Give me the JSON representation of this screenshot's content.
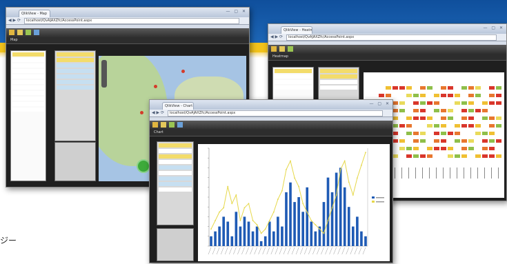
{
  "caption": "ジー",
  "colors": {
    "banner_blue": "#1d66b6",
    "banner_yellow": "#f1c21b",
    "bar": "#1f5bb5",
    "line": "#e6d84a"
  },
  "left_window": {
    "tab_title": "QlikView - Map",
    "url": "localhost/QvAJAXZfc/AccessPoint.aspx",
    "sheet_label": "Map",
    "icons": [
      "back-icon",
      "forward-icon",
      "reload-icon",
      "star-icon",
      "wrench-icon"
    ]
  },
  "right_window": {
    "tab_title": "QlikView - Heatmap",
    "url": "localhost/QvAJAXZfc/AccessPoint.aspx",
    "sheet_label": "Heatmap"
  },
  "front_window": {
    "tab_title": "QlikView - Chart",
    "url": "localhost/QvAJAXZfc/AccessPoint.aspx",
    "sheet_label": "Chart"
  },
  "chart_data": {
    "type": "bar",
    "series": [
      {
        "values": [
          2,
          3,
          4,
          6,
          5,
          2,
          7,
          4,
          6,
          5,
          3,
          4,
          1,
          2,
          5,
          3,
          6,
          4,
          11,
          13,
          9,
          10,
          7,
          12,
          5,
          3,
          4,
          9,
          14,
          11,
          15,
          16,
          12,
          8,
          4,
          6,
          3,
          2
        ]
      },
      {
        "values": [
          4,
          6,
          8,
          9,
          14,
          10,
          12,
          6,
          9,
          10,
          6,
          5,
          3,
          4,
          6,
          8,
          11,
          13,
          18,
          20,
          16,
          14,
          10,
          8,
          6,
          5,
          4,
          3,
          6,
          9,
          12,
          18,
          20,
          15,
          12,
          16,
          19,
          22
        ]
      }
    ],
    "ylim": [
      0,
      20
    ],
    "legend_position": "right"
  }
}
